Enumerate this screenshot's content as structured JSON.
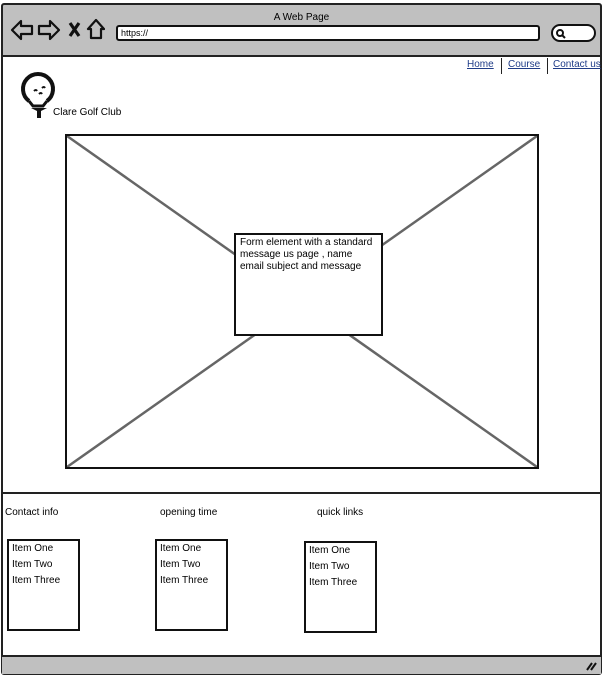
{
  "browser": {
    "title": "A Web Page",
    "url": "https://"
  },
  "nav": {
    "items": [
      {
        "label": "Home"
      },
      {
        "label": "Course"
      },
      {
        "label": "Contact us"
      }
    ]
  },
  "brand": {
    "name": "Clare Golf Club"
  },
  "main": {
    "note": "Form element with a standard message us page , name email subject and message"
  },
  "footer": {
    "columns": [
      {
        "heading": "Contact info",
        "items": [
          "Item One",
          "Item Two",
          "Item Three"
        ]
      },
      {
        "heading": "opening time",
        "items": [
          "Item One",
          "Item Two",
          "Item Three"
        ]
      },
      {
        "heading": "quick links",
        "items": [
          "Item One",
          "Item Two",
          "Item Three"
        ]
      }
    ]
  }
}
